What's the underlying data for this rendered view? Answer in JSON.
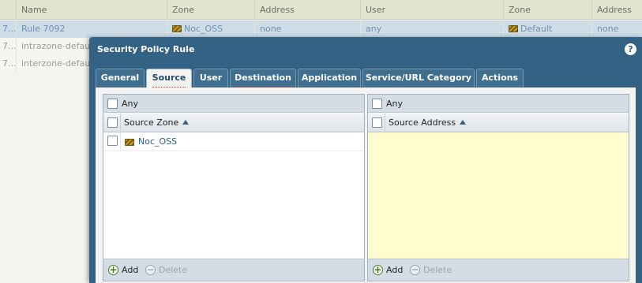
{
  "table": {
    "columns": [
      "Name",
      "Zone",
      "Address",
      "User",
      "Zone",
      "Address"
    ],
    "rows": [
      {
        "num": "7...",
        "name": "Rule 7092",
        "src_zone": "Noc_OSS",
        "src_address": "none",
        "user": "any",
        "dst_zone": "Default",
        "dst_address": "none"
      },
      {
        "num": "7...",
        "name": "intrazone-default"
      },
      {
        "num": "7...",
        "name": "interzone-default"
      }
    ]
  },
  "dialog": {
    "title": "Security Policy Rule",
    "help_icon": "?",
    "tabs": [
      "General",
      "Source",
      "User",
      "Destination",
      "Application",
      "Service/URL Category",
      "Actions"
    ],
    "active_tab": "Source"
  },
  "source_zone_panel": {
    "any_label": "Any",
    "column_title": "Source Zone",
    "items": [
      "Noc_OSS"
    ],
    "add_label": "Add",
    "delete_label": "Delete"
  },
  "source_address_panel": {
    "any_label": "Any",
    "column_title": "Source Address",
    "items": [],
    "add_label": "Add",
    "delete_label": "Delete"
  },
  "colors": {
    "dialog_bg": "#336284",
    "tab_inactive": "#3f6e8f",
    "highlight_yellow": "#fffdd0",
    "selected_row": "#cfdde8"
  },
  "icons": {
    "zone": "zone-icon",
    "help": "help-icon",
    "sort": "sort-ascending-icon",
    "add": "add-icon",
    "delete": "delete-icon"
  }
}
